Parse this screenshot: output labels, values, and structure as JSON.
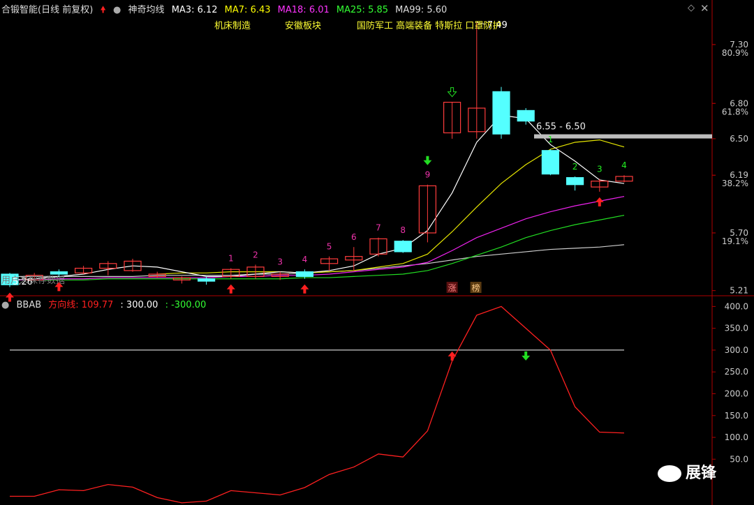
{
  "header": {
    "title": "合锻智能(日线 前复权)",
    "indicator_name": "神奇均线",
    "ma": [
      {
        "label": "MA3: 6.12",
        "color": "#ffffff"
      },
      {
        "label": "MA7: 6.43",
        "color": "#ffff00"
      },
      {
        "label": "MA18: 6.01",
        "color": "#ff33ff"
      },
      {
        "label": "MA25: 5.85",
        "color": "#33ff33"
      },
      {
        "label": "MA99: 5.60",
        "color": "#dddddd"
      }
    ]
  },
  "concept_tags": [
    "机床制造",
    "安徽板块",
    "国防军工 高端装备 特斯拉 口罩防护"
  ],
  "price_axis": [
    {
      "label": "7.30",
      "pct": ""
    },
    {
      "label": "80.9%",
      "pct": "pct"
    },
    {
      "label": "6.80",
      "pct": ""
    },
    {
      "label": "61.8%",
      "pct": "pct"
    },
    {
      "label": "6.50",
      "pct": ""
    },
    {
      "label": "6.19",
      "pct": ""
    },
    {
      "label": "38.2%",
      "pct": "pct"
    },
    {
      "label": "5.70",
      "pct": ""
    },
    {
      "label": "19.1%",
      "pct": "pct"
    },
    {
      "label": "5.21",
      "pct": ""
    }
  ],
  "annotations": {
    "high": "7.49",
    "low": "5.26",
    "zone": "6.55 - 6.50",
    "bottom_left": "用户未保存数据",
    "zhang": "涨",
    "bang": "榜"
  },
  "sub_header": {
    "name": "BBAB",
    "line_label": "方向线: 109.77",
    "upper": ": 300.00",
    "lower": ": -300.00"
  },
  "sub_axis": [
    "400.0",
    "350.0",
    "300.0",
    "250.0",
    "200.0",
    "150.0",
    "100.0",
    "50.0"
  ],
  "watermark": "展锋",
  "chart_data": {
    "type": "candlestick",
    "candles": [
      {
        "o": 5.35,
        "c": 5.26,
        "h": 5.36,
        "l": 5.24
      },
      {
        "o": 5.3,
        "c": 5.34,
        "h": 5.36,
        "l": 5.29
      },
      {
        "o": 5.37,
        "c": 5.35,
        "h": 5.39,
        "l": 5.33
      },
      {
        "o": 5.36,
        "c": 5.4,
        "h": 5.42,
        "l": 5.35
      },
      {
        "o": 5.4,
        "c": 5.44,
        "h": 5.46,
        "l": 5.34
      },
      {
        "o": 5.38,
        "c": 5.46,
        "h": 5.48,
        "l": 5.37
      },
      {
        "o": 5.33,
        "c": 5.35,
        "h": 5.37,
        "l": 5.32
      },
      {
        "o": 5.3,
        "c": 5.32,
        "h": 5.33,
        "l": 5.27
      },
      {
        "o": 5.31,
        "c": 5.29,
        "h": 5.33,
        "l": 5.26
      },
      {
        "o": 5.33,
        "c": 5.39,
        "h": 5.4,
        "l": 5.31
      },
      {
        "o": 5.33,
        "c": 5.41,
        "h": 5.43,
        "l": 5.31
      },
      {
        "o": 5.33,
        "c": 5.35,
        "h": 5.37,
        "l": 5.3
      },
      {
        "o": 5.37,
        "c": 5.33,
        "h": 5.39,
        "l": 5.31
      },
      {
        "o": 5.44,
        "c": 5.48,
        "h": 5.5,
        "l": 5.38
      },
      {
        "o": 5.47,
        "c": 5.5,
        "h": 5.58,
        "l": 5.38
      },
      {
        "o": 5.52,
        "c": 5.65,
        "h": 5.66,
        "l": 5.5
      },
      {
        "o": 5.63,
        "c": 5.54,
        "h": 5.64,
        "l": 5.53
      },
      {
        "o": 5.7,
        "c": 6.1,
        "h": 6.11,
        "l": 5.62
      },
      {
        "o": 6.55,
        "c": 6.81,
        "h": 6.81,
        "l": 6.5
      },
      {
        "o": 6.56,
        "c": 6.76,
        "h": 7.49,
        "l": 6.5
      },
      {
        "o": 6.9,
        "c": 6.54,
        "h": 6.94,
        "l": 6.5
      },
      {
        "o": 6.74,
        "c": 6.65,
        "h": 6.76,
        "l": 6.62
      },
      {
        "o": 6.4,
        "c": 6.2,
        "h": 6.41,
        "l": 6.19
      },
      {
        "o": 6.17,
        "c": 6.11,
        "h": 6.18,
        "l": 6.06
      },
      {
        "o": 6.09,
        "c": 6.14,
        "h": 6.16,
        "l": 6.05
      },
      {
        "o": 6.14,
        "c": 6.18,
        "h": 6.19,
        "l": 6.13
      }
    ],
    "ma3": [
      5.3,
      5.31,
      5.33,
      5.35,
      5.39,
      5.42,
      5.41,
      5.37,
      5.33,
      5.33,
      5.35,
      5.37,
      5.36,
      5.38,
      5.42,
      5.52,
      5.57,
      5.72,
      6.04,
      6.47,
      6.7,
      6.67,
      6.45,
      6.31,
      6.15,
      6.12
    ],
    "ma7": [
      null,
      null,
      null,
      null,
      null,
      null,
      5.35,
      5.36,
      5.36,
      5.37,
      5.37,
      5.37,
      5.36,
      5.37,
      5.38,
      5.41,
      5.44,
      5.52,
      5.71,
      5.92,
      6.12,
      6.28,
      6.41,
      6.47,
      6.49,
      6.43
    ],
    "ma18": [
      5.3,
      5.3,
      5.31,
      5.31,
      5.32,
      5.32,
      5.32,
      5.32,
      5.32,
      5.33,
      5.33,
      5.34,
      5.34,
      5.35,
      5.37,
      5.39,
      5.41,
      5.45,
      5.55,
      5.66,
      5.74,
      5.82,
      5.88,
      5.93,
      5.97,
      6.01
    ],
    "ma25": [
      5.3,
      5.3,
      5.3,
      5.3,
      5.31,
      5.31,
      5.31,
      5.31,
      5.31,
      5.31,
      5.31,
      5.31,
      5.32,
      5.32,
      5.33,
      5.34,
      5.35,
      5.38,
      5.44,
      5.51,
      5.58,
      5.66,
      5.72,
      5.77,
      5.81,
      5.85
    ],
    "ma99": [
      5.33,
      5.33,
      5.33,
      5.33,
      5.33,
      5.33,
      5.34,
      5.34,
      5.34,
      5.34,
      5.35,
      5.35,
      5.36,
      5.37,
      5.38,
      5.4,
      5.42,
      5.44,
      5.47,
      5.5,
      5.52,
      5.54,
      5.56,
      5.57,
      5.58,
      5.6
    ],
    "count_labels": [
      {
        "i": 9,
        "t": "1"
      },
      {
        "i": 10,
        "t": "2"
      },
      {
        "i": 11,
        "t": "3"
      },
      {
        "i": 12,
        "t": "4"
      },
      {
        "i": 13,
        "t": "5"
      },
      {
        "i": 14,
        "t": "6"
      },
      {
        "i": 15,
        "t": "7"
      },
      {
        "i": 16,
        "t": "8"
      },
      {
        "i": 17,
        "t": "9"
      },
      {
        "i": 22,
        "t": "1"
      },
      {
        "i": 23,
        "t": "2"
      },
      {
        "i": 24,
        "t": "3"
      },
      {
        "i": 25,
        "t": "4"
      }
    ],
    "buy_arrows": [
      0,
      2,
      9,
      12,
      24
    ],
    "sell_arrows": [
      17
    ],
    "outline_arrow": 18,
    "bbab": [
      -35,
      -35,
      -20,
      -22,
      -8,
      -14,
      -38,
      -50,
      -46,
      -22,
      -27,
      -32,
      -15,
      15,
      32,
      62,
      55,
      115,
      275,
      380,
      400,
      350,
      300,
      170,
      112,
      110
    ],
    "bbab_upper": 300,
    "bbab_signal_up": 18,
    "bbab_signal_down": 21,
    "price_range": [
      5.19,
      7.56
    ],
    "sub_range": [
      -55,
      415
    ]
  },
  "colors": {
    "up": "#ff3c3c",
    "down": "#54ffff",
    "border": "#b00000",
    "bbab": "#ff2020"
  }
}
